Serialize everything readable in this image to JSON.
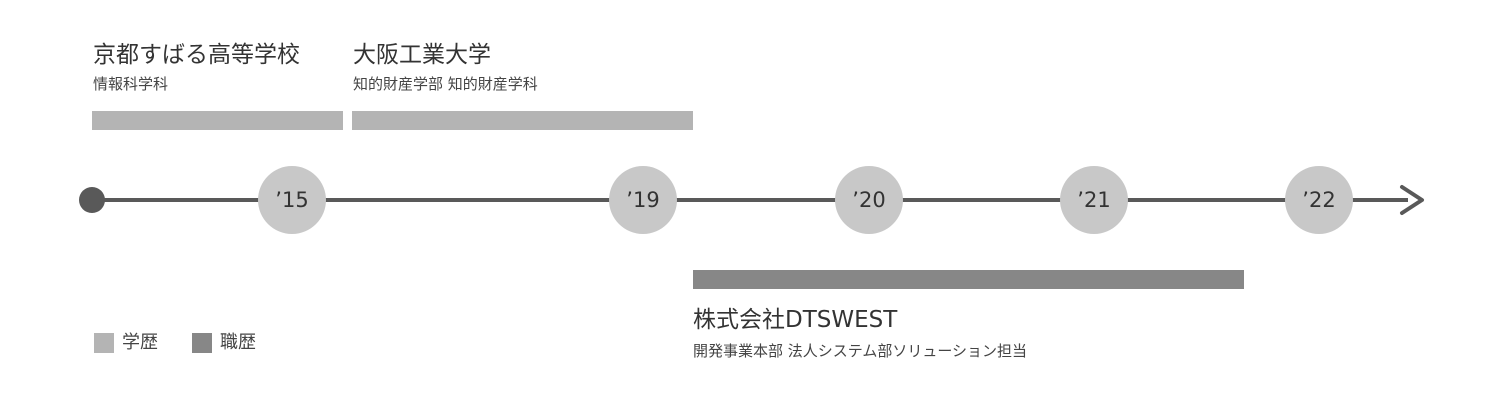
{
  "education": [
    {
      "school": "京都すばる高等学校",
      "department": "情報科学科"
    },
    {
      "school": "大阪工業大学",
      "department": "知的財産学部 知的財産学科"
    }
  ],
  "work": [
    {
      "company": "株式会社DTSWEST",
      "department": "開発事業本部 法人システム部ソリューション担当"
    }
  ],
  "timeline": {
    "years": [
      "’15",
      "’19",
      "’20",
      "’21",
      "’22"
    ]
  },
  "legend": {
    "education": "学歴",
    "work": "職歴"
  },
  "colors": {
    "education_bar": "#b4b4b4",
    "work_bar": "#878787",
    "axis": "#595959",
    "node": "#c8c8c8"
  }
}
